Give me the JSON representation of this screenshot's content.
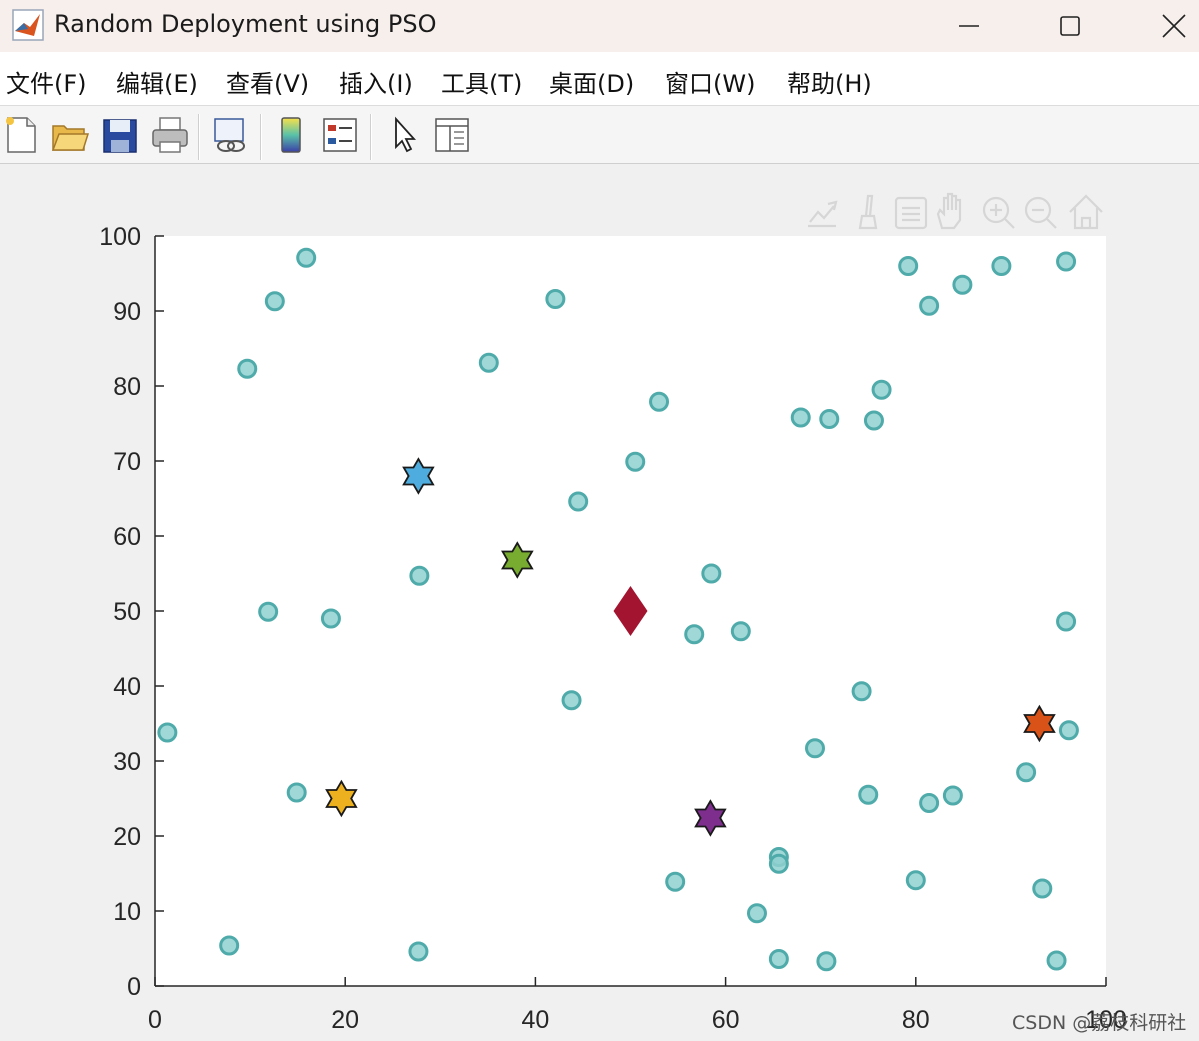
{
  "window": {
    "title": "Random Deployment using PSO",
    "minimize_icon": "minimize-icon",
    "maximize_icon": "maximize-icon",
    "close_icon": "close-icon"
  },
  "menu": [
    "文件(F)",
    "编辑(E)",
    "查看(V)",
    "插入(I)",
    "工具(T)",
    "桌面(D)",
    "窗口(W)",
    "帮助(H)"
  ],
  "toolbar": {
    "buttons": [
      "new-figure-icon",
      "open-file-icon",
      "save-icon",
      "print-icon",
      "link-plot-icon",
      "colorbar-icon",
      "legend-icon",
      "pointer-icon",
      "property-inspector-icon"
    ]
  },
  "axes_toolbar": [
    "export-icon",
    "brush-icon",
    "data-tips-icon",
    "pan-icon",
    "zoom-in-icon",
    "zoom-out-icon",
    "home-icon"
  ],
  "chart_data": {
    "type": "scatter",
    "title": "",
    "xlabel": "",
    "ylabel": "",
    "xlim": [
      0,
      100
    ],
    "ylim": [
      0,
      100
    ],
    "xticks": [
      "0",
      "20",
      "40",
      "60",
      "80",
      "100"
    ],
    "yticks": [
      "0",
      "10",
      "20",
      "30",
      "40",
      "50",
      "60",
      "70",
      "80",
      "90",
      "100"
    ],
    "grid": false,
    "series": [
      {
        "marker": "circle",
        "color": "#8fd0d0",
        "edge": "#4faaaa",
        "points": [
          [
            1.3,
            33.8
          ],
          [
            7.8,
            5.4
          ],
          [
            9.7,
            82.3
          ],
          [
            11.9,
            49.9
          ],
          [
            12.6,
            91.3
          ],
          [
            14.9,
            25.8
          ],
          [
            15.9,
            97.1
          ],
          [
            18.5,
            49.0
          ],
          [
            27.8,
            54.7
          ],
          [
            27.7,
            4.6
          ],
          [
            35.1,
            83.1
          ],
          [
            42.1,
            91.6
          ],
          [
            43.8,
            38.1
          ],
          [
            44.5,
            64.6
          ],
          [
            50.5,
            69.9
          ],
          [
            53.0,
            77.9
          ],
          [
            54.7,
            13.9
          ],
          [
            56.7,
            46.9
          ],
          [
            58.5,
            55.0
          ],
          [
            61.6,
            47.3
          ],
          [
            63.3,
            9.7
          ],
          [
            65.6,
            17.2
          ],
          [
            65.6,
            16.3
          ],
          [
            65.6,
            3.6
          ],
          [
            67.9,
            75.8
          ],
          [
            69.4,
            31.7
          ],
          [
            70.6,
            3.3
          ],
          [
            70.9,
            75.6
          ],
          [
            74.3,
            39.3
          ],
          [
            75.0,
            25.5
          ],
          [
            75.6,
            75.4
          ],
          [
            76.4,
            79.5
          ],
          [
            79.2,
            96.0
          ],
          [
            80.0,
            14.1
          ],
          [
            81.4,
            90.7
          ],
          [
            81.4,
            24.4
          ],
          [
            83.9,
            25.4
          ],
          [
            84.9,
            93.5
          ],
          [
            89.0,
            96.0
          ],
          [
            91.6,
            28.5
          ],
          [
            93.3,
            13.0
          ],
          [
            94.8,
            3.4
          ],
          [
            95.8,
            96.6
          ],
          [
            95.8,
            48.6
          ],
          [
            96.1,
            34.1
          ]
        ]
      },
      {
        "marker": "hexagram",
        "points": [
          {
            "x": 27.7,
            "y": 68.0,
            "color": "#4eacde"
          },
          {
            "x": 38.1,
            "y": 56.8,
            "color": "#77ac30"
          },
          {
            "x": 19.6,
            "y": 25.0,
            "color": "#edb120"
          },
          {
            "x": 58.4,
            "y": 22.4,
            "color": "#7e2f8e"
          },
          {
            "x": 93.0,
            "y": 35.0,
            "color": "#d95319"
          }
        ]
      },
      {
        "marker": "diamond",
        "points": [
          {
            "x": 50.0,
            "y": 50.0,
            "color": "#a2142f"
          }
        ]
      }
    ]
  },
  "watermark": "CSDN @荔枝科研社"
}
